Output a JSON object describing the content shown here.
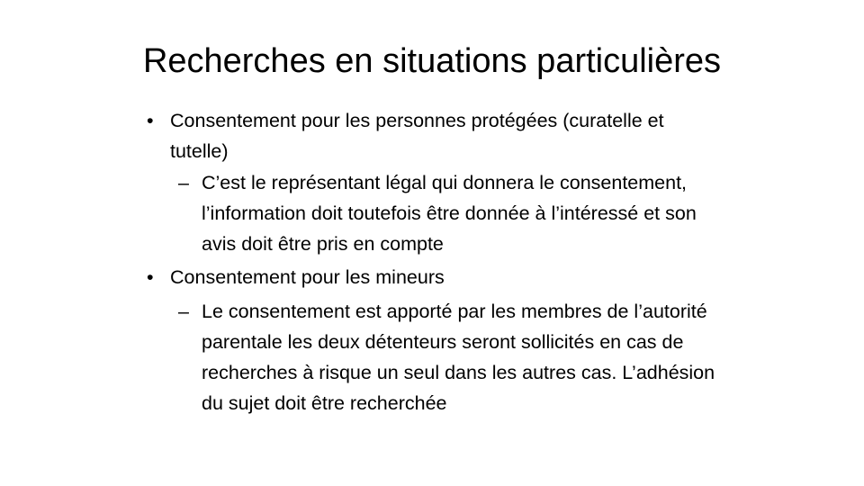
{
  "slide": {
    "title": "Recherches en situations particulières",
    "bullets": [
      {
        "marker": "•",
        "text": "Consentement pour les personnes protégées (curatelle et tutelle)"
      },
      {
        "marker": "–",
        "text": "C’est  le représentant légal qui donnera le consentement, l’information doit toutefois être donnée à l’intéressé et son avis doit être pris en compte"
      },
      {
        "marker": "•",
        "text": "Consentement pour les mineurs"
      },
      {
        "marker": "–",
        "text": "Le consentement est apporté par les membres de l’autorité parentale les deux détenteurs seront sollicités en cas de recherches à risque un seul dans les autres cas. L’adhésion du sujet doit être recherchée"
      }
    ]
  }
}
